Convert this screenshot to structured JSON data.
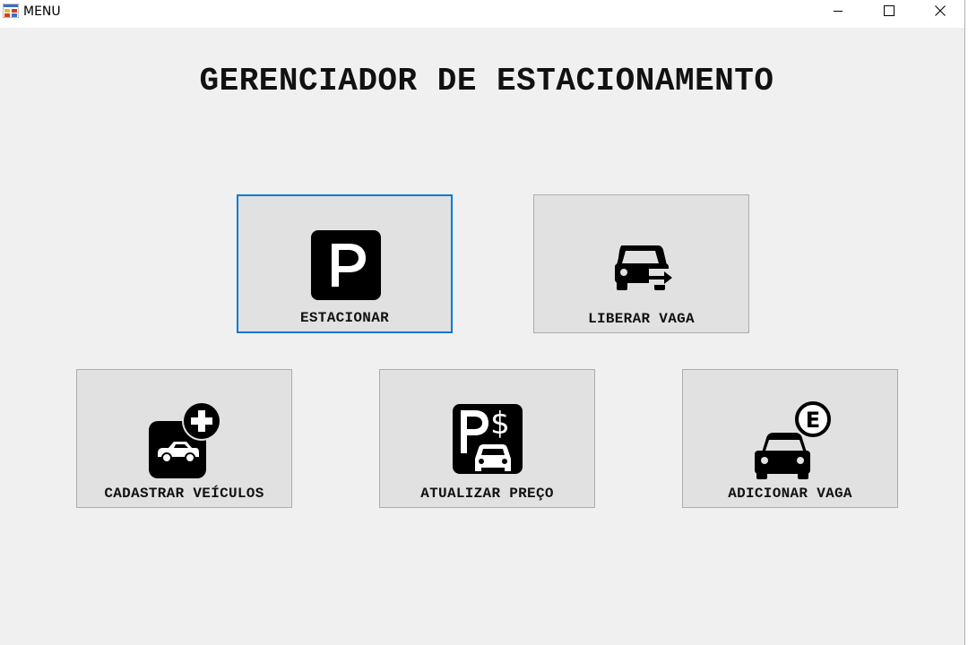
{
  "window": {
    "title": "MENU",
    "controls": {
      "minimize_icon": "minimize-icon",
      "maximize_icon": "maximize-icon",
      "close_icon": "close-icon"
    }
  },
  "main": {
    "heading": "GERENCIADOR DE ESTACIONAMENTO",
    "buttons": {
      "park": {
        "label": "ESTACIONAR",
        "icon": "parking-icon",
        "focused": true
      },
      "release": {
        "label": "LIBERAR VAGA",
        "icon": "car-exit-icon"
      },
      "register": {
        "label": "CADASTRAR VEÍCULOS",
        "icon": "add-car-icon"
      },
      "price": {
        "label": "ATUALIZAR PREÇO",
        "icon": "parking-price-icon"
      },
      "add_spot": {
        "label": "ADICIONAR VAGA",
        "icon": "parking-spot-icon"
      }
    }
  },
  "colors": {
    "background": "#f0f0f0",
    "tile": "#e1e1e1",
    "tile_border": "#adadad",
    "focus_border": "#0078d7"
  }
}
